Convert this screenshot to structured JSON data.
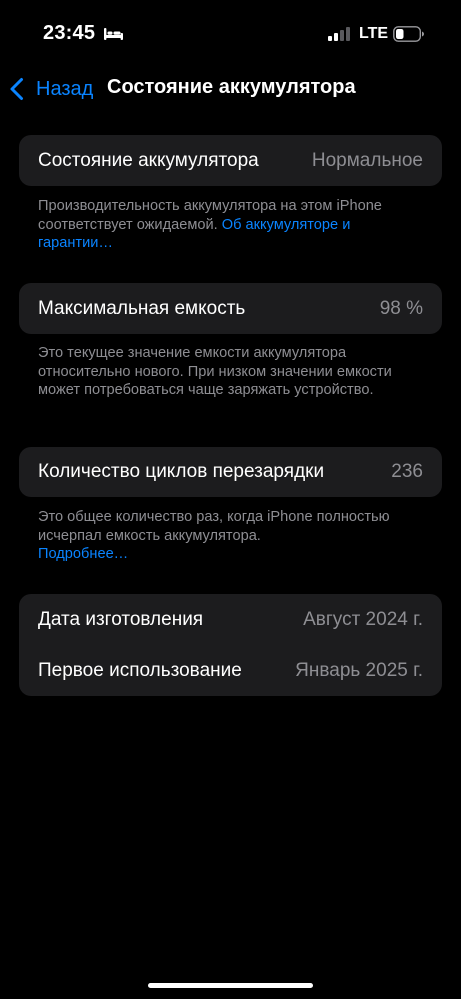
{
  "status_bar": {
    "time": "23:45",
    "sleep_icon": "bed-icon",
    "signal_icon": "cellular-signal-icon",
    "network": "LTE",
    "battery_icon": "battery-icon"
  },
  "nav": {
    "back_label": "Назад",
    "back_icon": "chevron-left-icon",
    "title": "Состояние аккумулятора"
  },
  "battery_health": {
    "label": "Состояние аккумулятора",
    "value": "Нормальное",
    "footnote_text": "Производительность аккумулятора на этом iPhone соответствует ожидаемой. ",
    "footnote_link": "Об аккумуляторе и гарантии…"
  },
  "max_capacity": {
    "label": "Максимальная емкость",
    "value": "98 %",
    "footnote_text": "Это текущее значение емкости аккумулятора относительно нового. При низком значении емкости может потребоваться чаще заряжать устройство."
  },
  "cycle_count": {
    "label": "Количество циклов перезарядки",
    "value": "236",
    "footnote_text": "Это общее количество раз, когда iPhone полностью исчерпал емкость аккумулятора.",
    "footnote_link": "Подробнее…"
  },
  "dates": {
    "manufacture_label": "Дата изготовления",
    "manufacture_value": "Август 2024 г.",
    "first_use_label": "Первое использование",
    "first_use_value": "Январь 2025 г."
  },
  "colors": {
    "background": "#000000",
    "card": "#1c1c1e",
    "accent": "#0a84ff",
    "secondary_text": "#8e8e93"
  }
}
